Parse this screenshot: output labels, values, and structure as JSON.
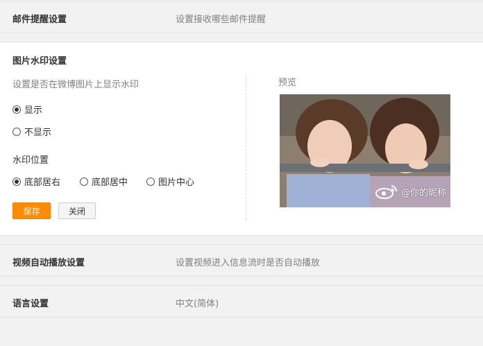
{
  "email_settings": {
    "title": "邮件提醒设置",
    "desc": "设置接收哪些邮件提醒"
  },
  "watermark_settings": {
    "title": "图片水印设置",
    "hint": "设置是否在微博图片上显示水印",
    "display_options": [
      "显示",
      "不显示"
    ],
    "display_selected": 0,
    "position_label": "水印位置",
    "position_options": [
      "底部居右",
      "底部居中",
      "图片中心"
    ],
    "position_selected": 0,
    "save_label": "保存",
    "close_label": "关闭",
    "preview_label": "预览",
    "watermark_text": "@你的昵称"
  },
  "video_settings": {
    "title": "视频自动播放设置",
    "desc": "设置视频进入信息流时是否自动播放"
  },
  "language_settings": {
    "title": "语言设置",
    "desc": "中文(简体)"
  },
  "colors": {
    "accent": "#ff8c00",
    "bar_bg": "#f2f2f2",
    "panel_bg": "#ffffff"
  }
}
